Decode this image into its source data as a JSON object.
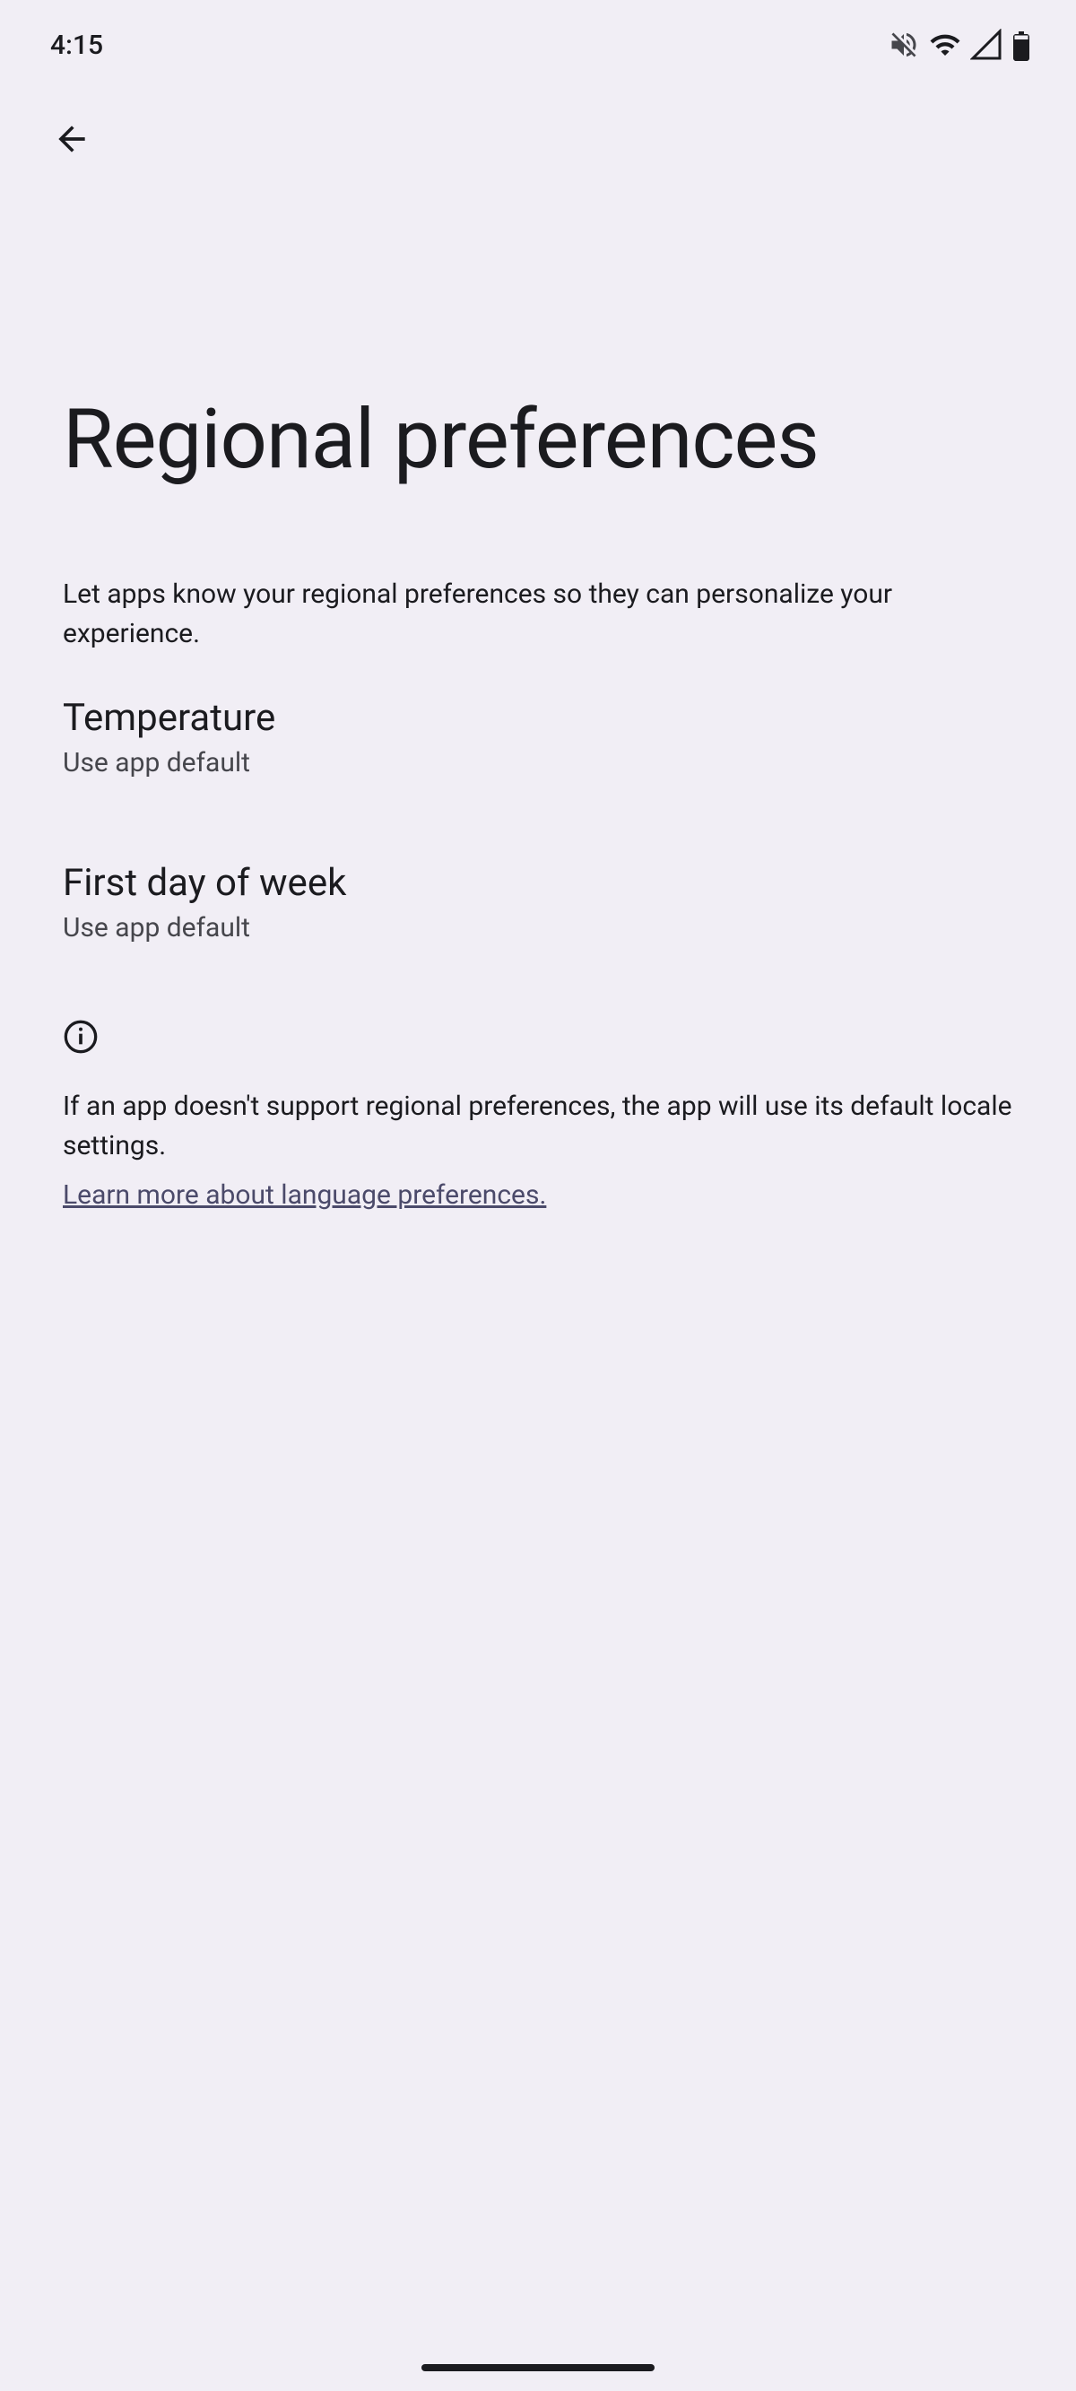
{
  "status": {
    "time": "4:15"
  },
  "page": {
    "title": "Regional preferences",
    "subtitle": "Let apps know your regional preferences so they can personalize your experience."
  },
  "settings": {
    "temperature": {
      "title": "Temperature",
      "value": "Use app default"
    },
    "firstDay": {
      "title": "First day of week",
      "value": "Use app default"
    }
  },
  "info": {
    "text": "If an app doesn't support regional preferences, the app will use its default locale settings.",
    "link": "Learn more about language preferences."
  }
}
